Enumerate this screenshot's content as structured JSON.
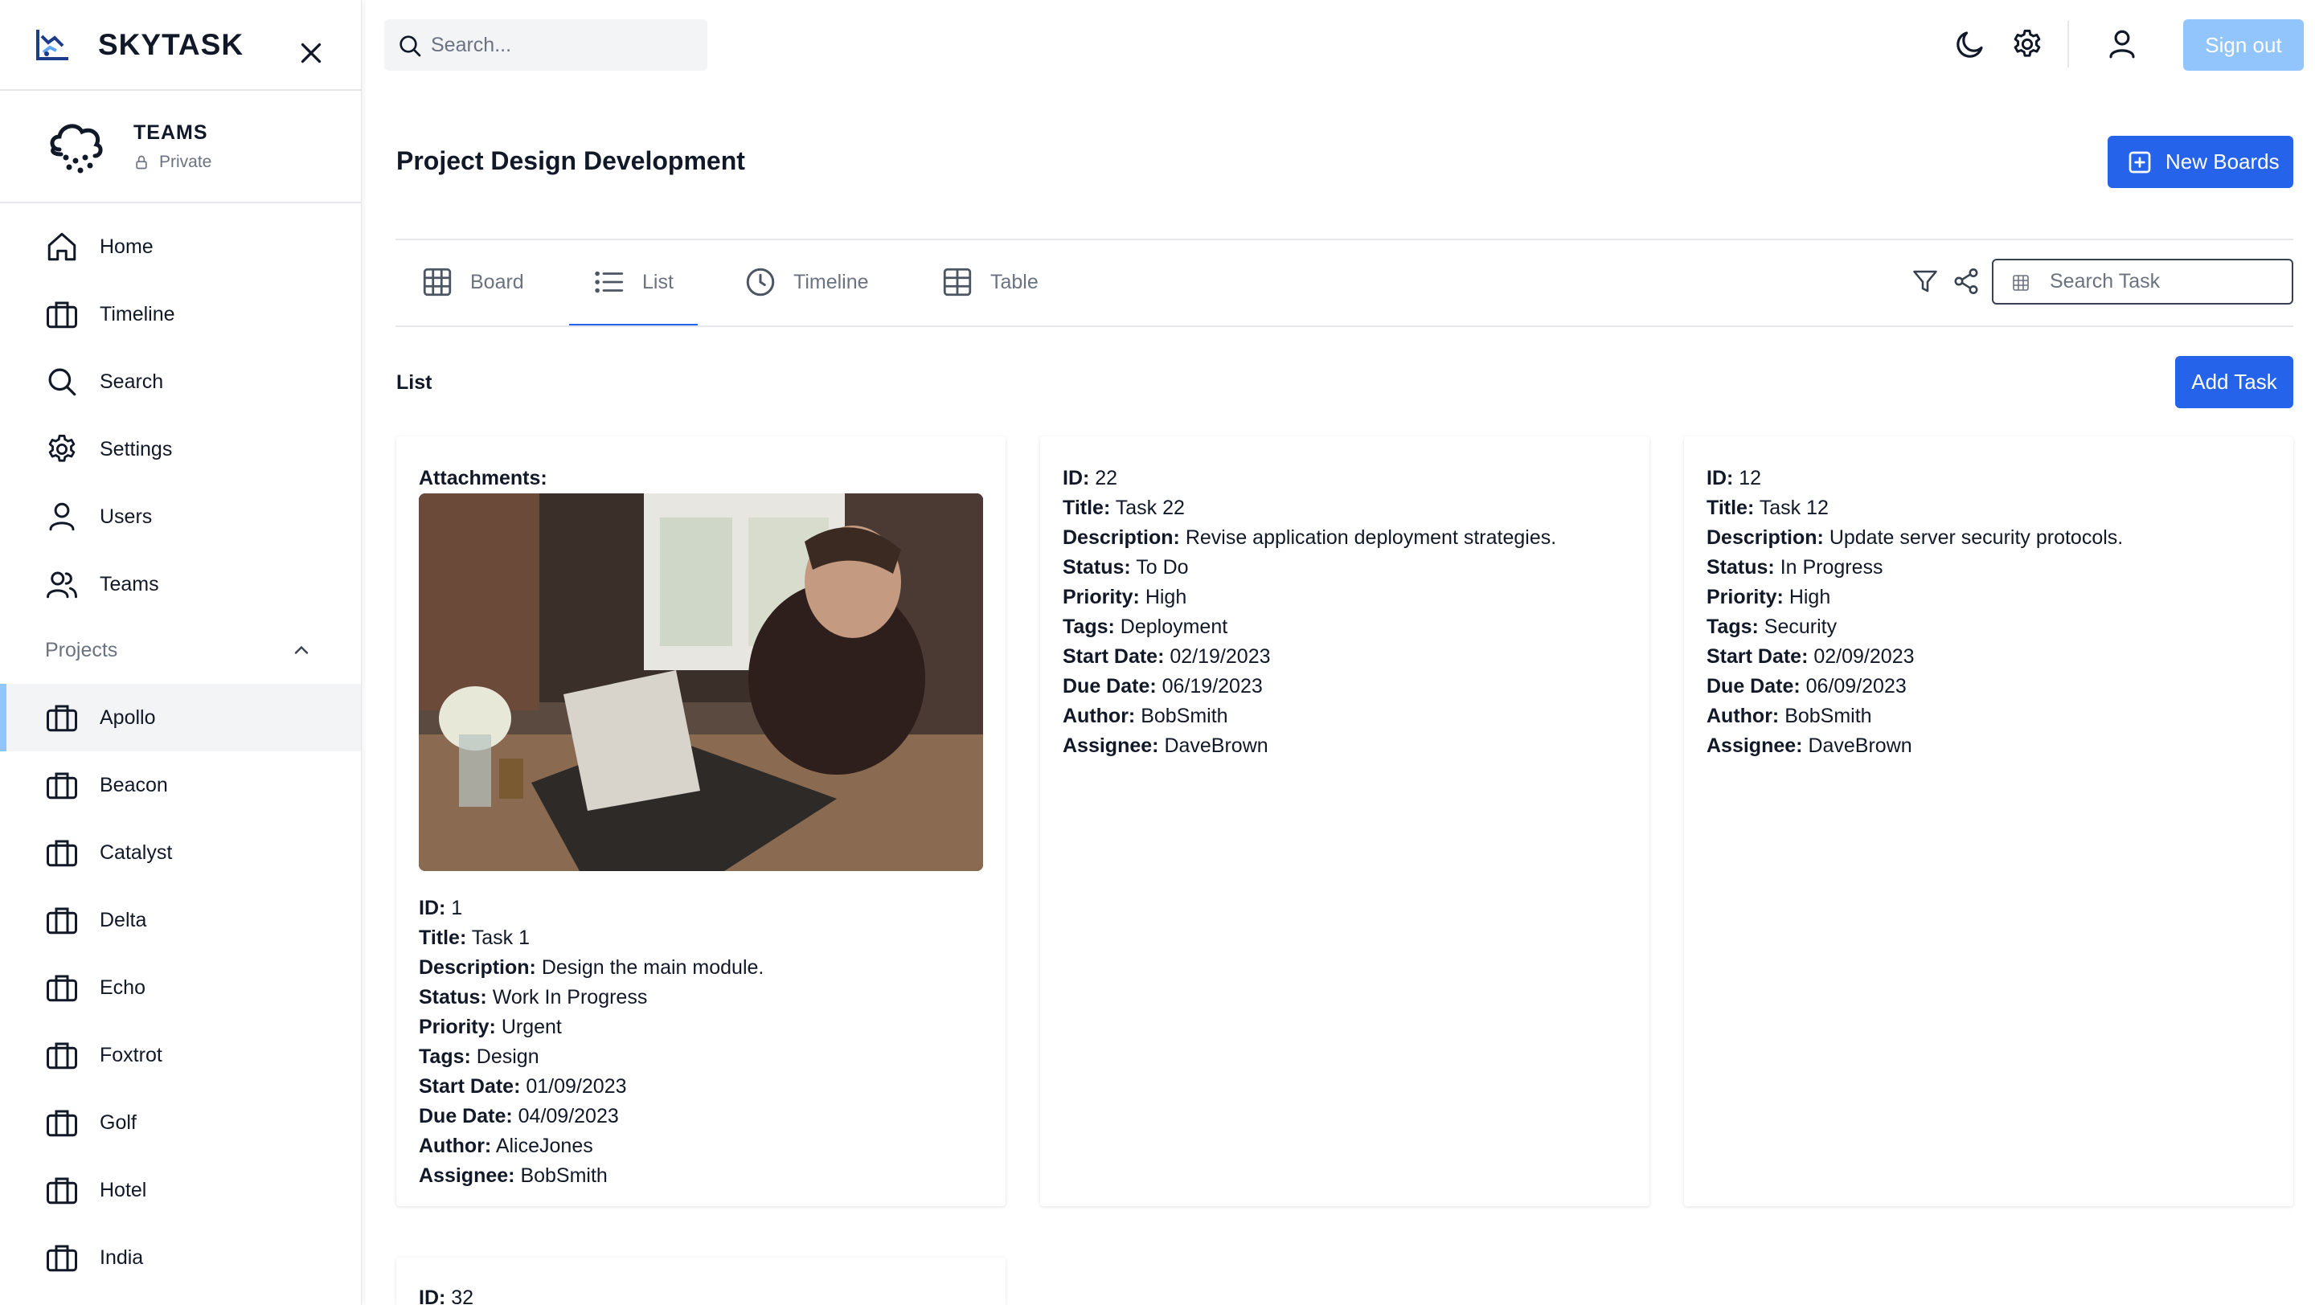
{
  "app": {
    "name": "SKYTASK"
  },
  "team": {
    "name": "TEAMS",
    "visibility": "Private"
  },
  "nav": [
    {
      "label": "Home",
      "icon": "home-icon"
    },
    {
      "label": "Timeline",
      "icon": "briefcase-icon"
    },
    {
      "label": "Search",
      "icon": "search-icon"
    },
    {
      "label": "Settings",
      "icon": "gear-icon"
    },
    {
      "label": "Users",
      "icon": "user-icon"
    },
    {
      "label": "Teams",
      "icon": "users-icon"
    }
  ],
  "projects": {
    "header": "Projects",
    "items": [
      "Apollo",
      "Beacon",
      "Catalyst",
      "Delta",
      "Echo",
      "Foxtrot",
      "Golf",
      "Hotel",
      "India"
    ],
    "active": "Apollo"
  },
  "topbar": {
    "search_placeholder": "Search...",
    "signout_label": "Sign out"
  },
  "page": {
    "title": "Project Design Development",
    "new_boards_label": "New Boards"
  },
  "tabs": [
    {
      "label": "Board",
      "icon": "grid-icon"
    },
    {
      "label": "List",
      "icon": "list-icon",
      "active": true
    },
    {
      "label": "Timeline",
      "icon": "clock-icon"
    },
    {
      "label": "Table",
      "icon": "table-icon"
    }
  ],
  "task_search_placeholder": "Search Task",
  "list": {
    "label": "List",
    "add_task_label": "Add Task"
  },
  "labels": {
    "attachments": "Attachments:",
    "id": "ID:",
    "title": "Title:",
    "description": "Description:",
    "status": "Status:",
    "priority": "Priority:",
    "tags": "Tags:",
    "start_date": "Start Date:",
    "due_date": "Due Date:",
    "author": "Author:",
    "assignee": "Assignee:"
  },
  "tasks": [
    {
      "id": "1",
      "title": "Task 1",
      "description": "Design the main module.",
      "status": "Work In Progress",
      "priority": "Urgent",
      "tags": "Design",
      "start_date": "01/09/2023",
      "due_date": "04/09/2023",
      "author": "AliceJones",
      "assignee": "BobSmith"
    },
    {
      "id": "22",
      "title": "Task 22",
      "description": "Revise application deployment strategies.",
      "status": "To Do",
      "priority": "High",
      "tags": "Deployment",
      "start_date": "02/19/2023",
      "due_date": "06/19/2023",
      "author": "BobSmith",
      "assignee": "DaveBrown"
    },
    {
      "id": "12",
      "title": "Task 12",
      "description": "Update server security protocols.",
      "status": "In Progress",
      "priority": "High",
      "tags": "Security",
      "start_date": "02/09/2023",
      "due_date": "06/09/2023",
      "author": "BobSmith",
      "assignee": "DaveBrown"
    },
    {
      "id": "32"
    }
  ],
  "colors": {
    "primary": "#2563eb",
    "signout": "#93c5fd",
    "active_bar": "#93c5fd",
    "text": "#111827",
    "muted": "#6b7280"
  }
}
